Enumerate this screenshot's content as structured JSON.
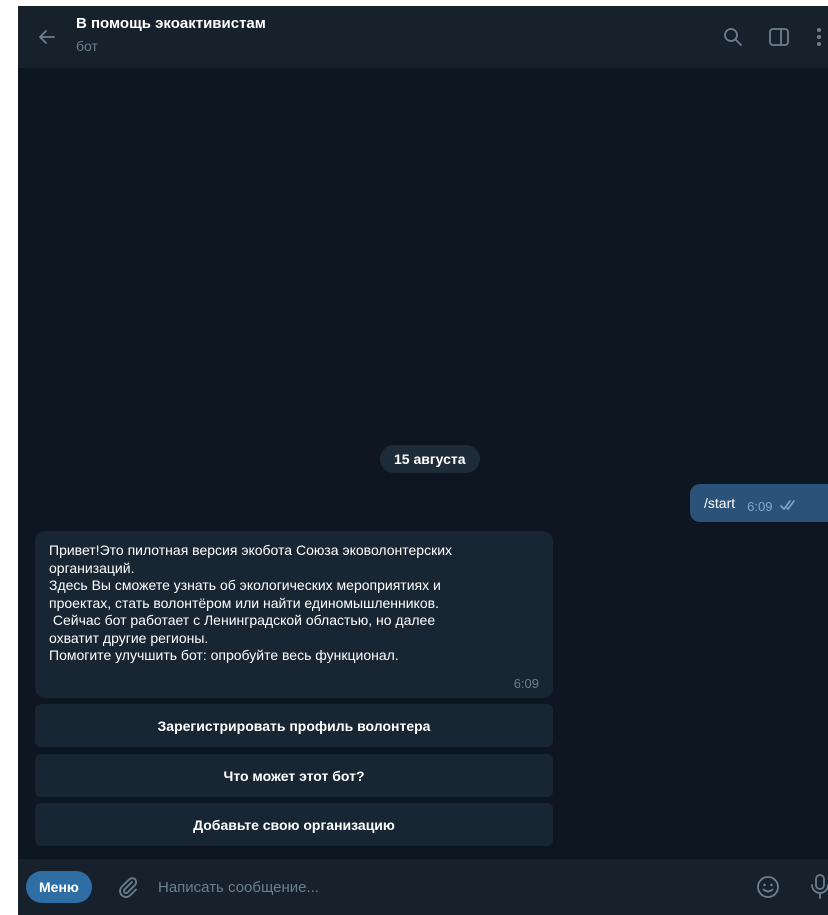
{
  "header": {
    "title": "В помощь экоактивистам",
    "subtitle": "бот",
    "icons": [
      "back-arrow-icon",
      "search-icon",
      "side-panel-icon",
      "more-vertical-icon"
    ]
  },
  "chat": {
    "date": "15 августа",
    "outgoing": {
      "text": "/start",
      "time": "6:09",
      "status": "read"
    },
    "incoming": {
      "lines": [
        "Привет!Это пилотная версия экобота Союза эковолонтерских",
        "организаций.",
        "Здесь Вы сможете узнать об экологических мероприятиях и",
        "проектах, стать волонтёром или найти единомышленников.",
        " Сейчас бот работает с Ленинградской областью, но далее",
        "охватит другие регионы.",
        "Помогите улучшить бот: опробуйте весь функционал."
      ],
      "time": "6:09"
    },
    "keyboard": [
      "Зарегистрировать профиль волонтера",
      "Что может этот бот?",
      "Добавьте свою организацию"
    ]
  },
  "input_bar": {
    "menu_label": "Меню",
    "placeholder": "Написать сообщение...",
    "icons": [
      "paperclip-icon",
      "emoji-icon",
      "microphone-icon"
    ]
  },
  "colors": {
    "background": "#0e1621",
    "panel": "#17212b",
    "incoming_bubble": "#182533",
    "outgoing_bubble": "#2b5278",
    "accent": "#2f6ea5",
    "muted_text": "#6d7f8f"
  }
}
